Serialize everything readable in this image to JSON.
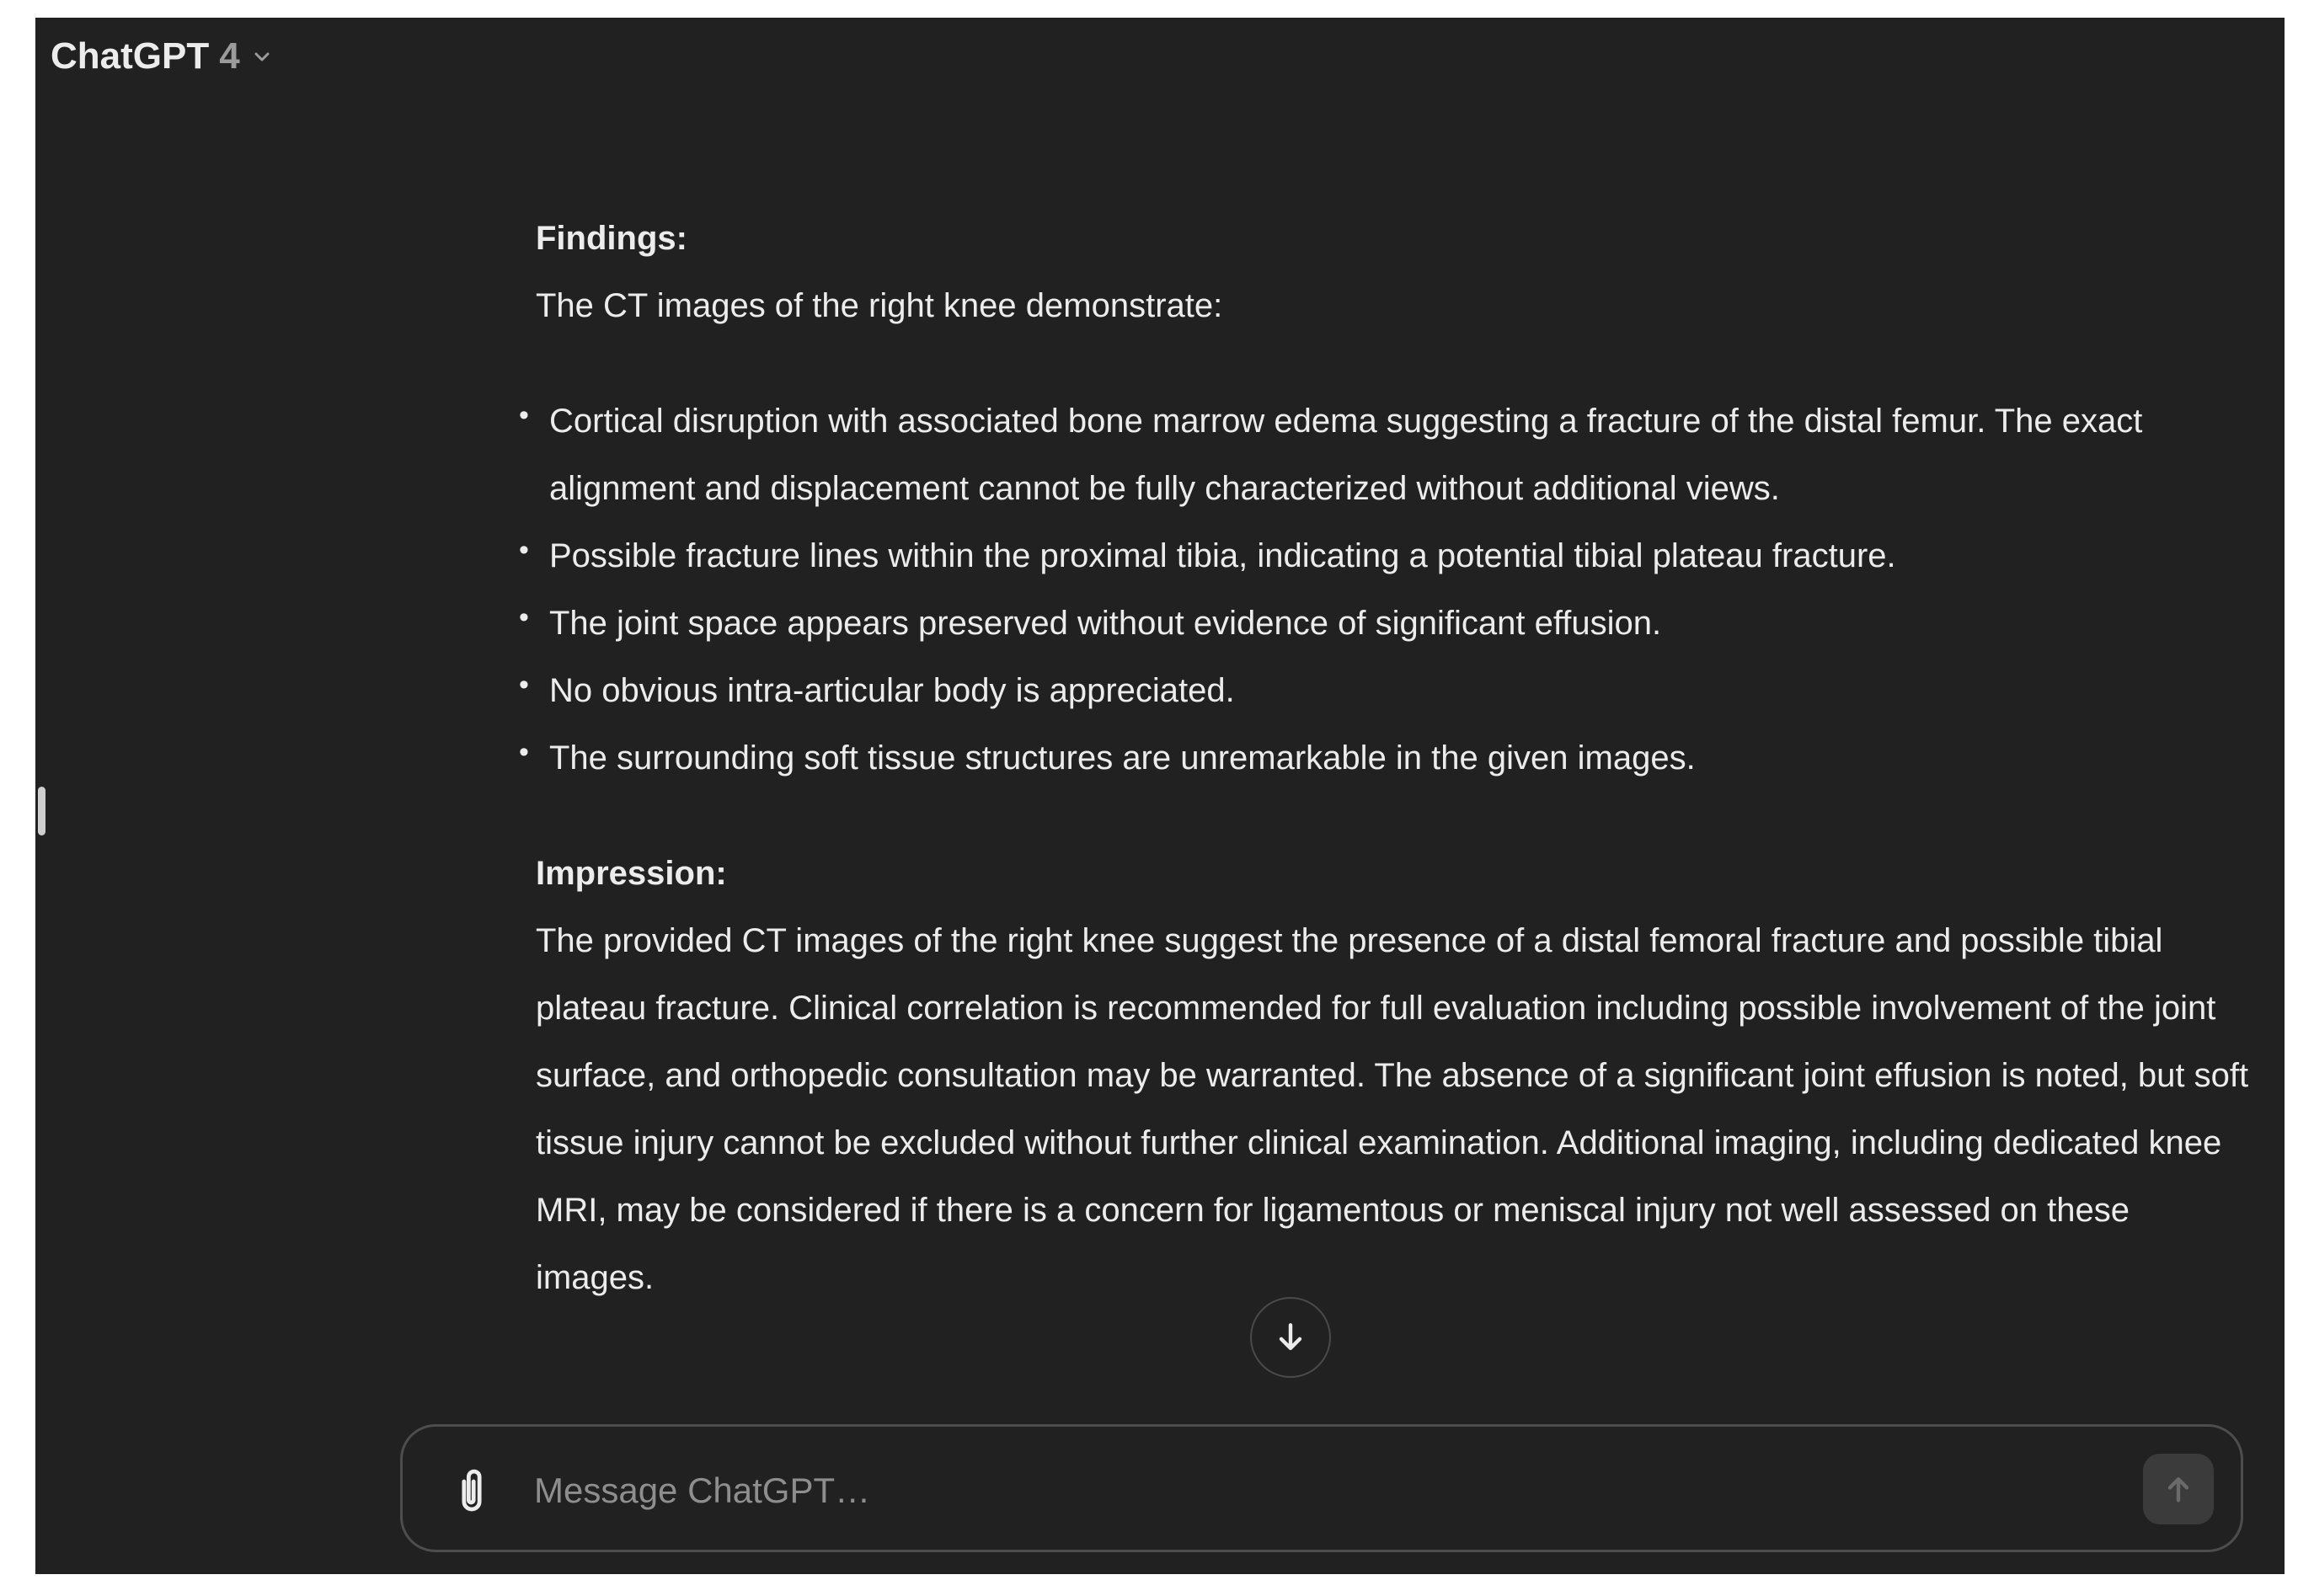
{
  "header": {
    "model_name": "ChatGPT",
    "model_version": "4",
    "dropdown_icon": "chevron-down-icon"
  },
  "message": {
    "findings_heading": "Findings:",
    "findings_intro": "The CT images of the right knee demonstrate:",
    "findings_items": [
      "Cortical disruption with associated bone marrow edema suggesting a fracture of the distal femur. The exact alignment and displacement cannot be fully characterized without additional views.",
      "Possible fracture lines within the proximal tibia, indicating a potential tibial plateau fracture.",
      "The joint space appears preserved without evidence of significant effusion.",
      "No obvious intra-articular body is appreciated.",
      "The surrounding soft tissue structures are unremarkable in the given images."
    ],
    "impression_heading": "Impression:",
    "impression_text": "The provided CT images of the right knee suggest the presence of a distal femoral fracture and possible tibial plateau fracture. Clinical correlation is recommended for full evaluation including possible involvement of the joint surface, and orthopedic consultation may be warranted. The absence of a significant joint effusion is noted, but soft tissue injury cannot be excluded without further clinical examination. Additional imaging, including dedicated knee MRI, may be considered if there is a concern for ligamentous or meniscal injury not well assessed on these images."
  },
  "composer": {
    "placeholder": "Message ChatGPT…",
    "attach_icon": "paperclip-icon",
    "send_icon": "arrow-up-icon"
  },
  "scroll": {
    "icon": "arrow-down-icon"
  },
  "colors": {
    "background": "#212121",
    "text": "#ececec",
    "muted": "#9b9b9b",
    "border": "#4d4d4d"
  }
}
